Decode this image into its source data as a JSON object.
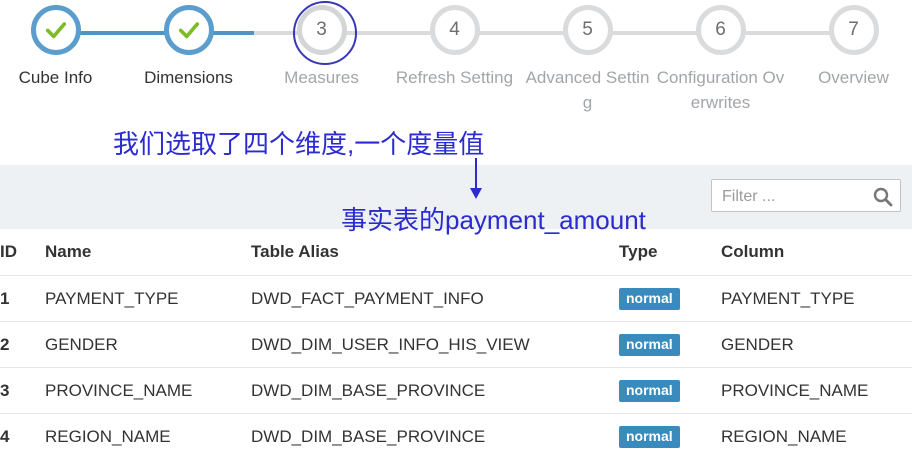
{
  "wizard": {
    "steps": [
      {
        "number": "",
        "label": "Cube Info",
        "state": "done"
      },
      {
        "number": "",
        "label": "Dimensions",
        "state": "done"
      },
      {
        "number": "3",
        "label": "Measures",
        "state": "active"
      },
      {
        "number": "4",
        "label": "Refresh Setting",
        "state": "pending"
      },
      {
        "number": "5",
        "label": "Advanced Setting",
        "state": "pending"
      },
      {
        "number": "6",
        "label": "Configuration Overwrites",
        "state": "pending"
      },
      {
        "number": "7",
        "label": "Overview",
        "state": "pending"
      }
    ]
  },
  "annotations": {
    "top": "我们选取了四个维度,一个度量值",
    "bottom": "事实表的payment_amount"
  },
  "toolbar": {
    "filter_placeholder": "Filter ..."
  },
  "table": {
    "headers": {
      "id": "ID",
      "name": "Name",
      "alias": "Table Alias",
      "type": "Type",
      "column": "Column"
    },
    "rows": [
      {
        "id": "1",
        "name": "PAYMENT_TYPE",
        "alias": "DWD_FACT_PAYMENT_INFO",
        "type": "normal",
        "column": "PAYMENT_TYPE"
      },
      {
        "id": "2",
        "name": "GENDER",
        "alias": "DWD_DIM_USER_INFO_HIS_VIEW",
        "type": "normal",
        "column": "GENDER"
      },
      {
        "id": "3",
        "name": "PROVINCE_NAME",
        "alias": "DWD_DIM_BASE_PROVINCE",
        "type": "normal",
        "column": "PROVINCE_NAME"
      },
      {
        "id": "4",
        "name": "REGION_NAME",
        "alias": "DWD_DIM_BASE_PROVINCE",
        "type": "normal",
        "column": "REGION_NAME"
      }
    ]
  },
  "colors": {
    "done": "#5b9dcc",
    "pending": "#d9dbdd",
    "badge": "#3a8bbd",
    "annotation": "#2b2bcf",
    "check": "#7fbb28"
  }
}
